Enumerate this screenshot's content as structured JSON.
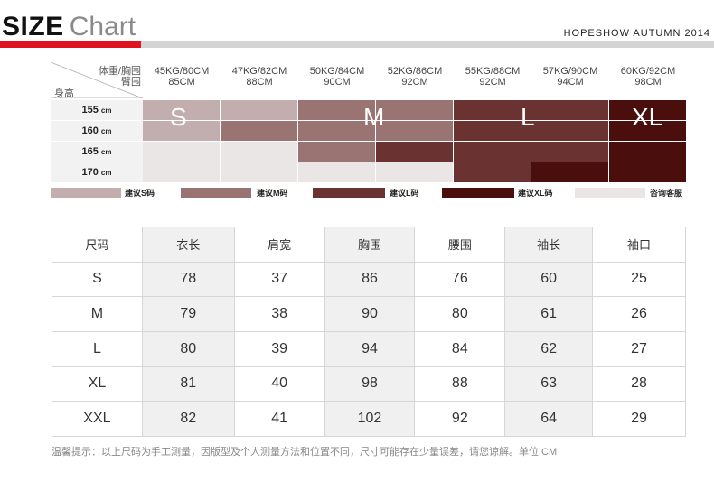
{
  "header": {
    "title_bold": "SIZE",
    "title_light": "Chart",
    "brand_line": "HOPESHOW AUTUMN 2014"
  },
  "grid": {
    "corner_top_1": "体重/胸围",
    "corner_top_2": "臂围",
    "corner_bottom": "身高",
    "columns": [
      {
        "l1": "45KG/80CM",
        "l2": "85CM"
      },
      {
        "l1": "47KG/82CM",
        "l2": "88CM"
      },
      {
        "l1": "50KG/84CM",
        "l2": "90CM"
      },
      {
        "l1": "52KG/86CM",
        "l2": "92CM"
      },
      {
        "l1": "55KG/88CM",
        "l2": "92CM"
      },
      {
        "l1": "57KG/90CM",
        "l2": "94CM"
      },
      {
        "l1": "60KG/92CM",
        "l2": "98CM"
      }
    ],
    "rows": [
      {
        "height": "155",
        "unit": "cm"
      },
      {
        "height": "160",
        "unit": "cm"
      },
      {
        "height": "165",
        "unit": "cm"
      },
      {
        "height": "170",
        "unit": "cm"
      }
    ],
    "size_marks": [
      "S",
      "M",
      "L",
      "XL"
    ],
    "colors": {
      "S": "#c2aeae",
      "M": "#9a7373",
      "L": "#6a3230",
      "XL": "#4a0e0c",
      "consult": "#ebe6e6"
    },
    "cells": [
      [
        "S",
        "S",
        "M",
        "M",
        "L",
        "L",
        "XL"
      ],
      [
        "S",
        "M",
        "M",
        "M",
        "L",
        "L",
        "XL"
      ],
      [
        "consult",
        "consult",
        "M",
        "L",
        "L",
        "L",
        "XL"
      ],
      [
        "consult",
        "consult",
        "consult",
        "consult",
        "L",
        "XL",
        "XL"
      ]
    ]
  },
  "legend": [
    {
      "key": "S",
      "label": "建议S码"
    },
    {
      "key": "M",
      "label": "建议M码"
    },
    {
      "key": "L",
      "label": "建议L码"
    },
    {
      "key": "XL",
      "label": "建议XL码"
    },
    {
      "key": "consult",
      "label": "咨询客服"
    }
  ],
  "table": {
    "headers": [
      "尺码",
      "衣长",
      "肩宽",
      "胸围",
      "腰围",
      "袖长",
      "袖口"
    ],
    "rows": [
      [
        "S",
        "78",
        "37",
        "86",
        "76",
        "60",
        "25"
      ],
      [
        "M",
        "79",
        "38",
        "90",
        "80",
        "61",
        "26"
      ],
      [
        "L",
        "80",
        "39",
        "94",
        "84",
        "62",
        "27"
      ],
      [
        "XL",
        "81",
        "40",
        "98",
        "88",
        "63",
        "28"
      ],
      [
        "XXL",
        "82",
        "41",
        "102",
        "92",
        "64",
        "29"
      ]
    ]
  },
  "note": "温馨提示：以上尺码为手工测量，因版型及个人测量方法和位置不同，尺寸可能存在少量误差，请您谅解。单位:CM"
}
